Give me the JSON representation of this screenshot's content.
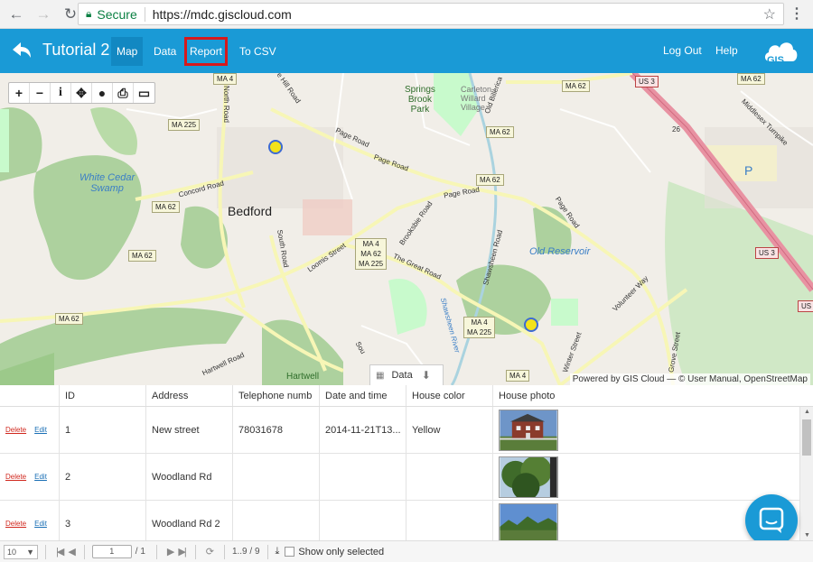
{
  "browser": {
    "secure_label": "Secure",
    "url": "https://mdc.giscloud.com"
  },
  "header": {
    "title": "Tutorial 2",
    "tabs": [
      {
        "label": "Map",
        "active": true
      },
      {
        "label": "Data",
        "active": false
      },
      {
        "label": "Report",
        "active": false,
        "highlighted": true
      },
      {
        "label": "To CSV",
        "active": false
      }
    ],
    "logout": "Log Out",
    "help": "Help",
    "logo_text": "GIS"
  },
  "map": {
    "toolbar_icons": [
      "zoom-in-icon",
      "zoom-out-icon",
      "info-icon",
      "pan-icon",
      "globe-icon",
      "print-icon",
      "layers-icon"
    ],
    "places": {
      "town": "Bedford",
      "white_cedar": "White Cedar\nSwamp",
      "old_reservoir": "Old Reservoir",
      "springs_brook": "Springs\nBrook\nPark",
      "carleton": "Carleton-\nWillard\nVillage",
      "hartwell": "Hartwell"
    },
    "roads": {
      "north_road": "North Road",
      "page_road1": "Page Road",
      "page_road2": "Page Road",
      "page_road3": "Page Road",
      "page_road4": "Page Road",
      "concord_road": "Concord Road",
      "south_road": "South Road",
      "loomis": "Loomis Street",
      "great_road": "The Great Road",
      "brooksbie": "Brooksbie Road",
      "shawsheen_road": "Shawsheen Road",
      "shawsheen_river": "Shawsheen River",
      "hartwell_road": "Hartwell Road",
      "volunteer": "Volunteer Way",
      "winter": "Winter Street",
      "grove": "Grove Street",
      "hill_road": "e Hill Road",
      "middlesex": "Middlesex Turnpike",
      "old_billerica": "Old Billerica",
      "south_right": "Sou"
    },
    "shields": {
      "ma4_top": "MA 4",
      "ma225_left": "MA 225",
      "ma62_left1": "MA 62",
      "ma62_left2": "MA 62",
      "ma62_left3": "MA 62",
      "ma62_top_right": "MA 62",
      "ma62_mid": "MA 62",
      "ma62_mid2": "MA 62",
      "ma62_far_right": "MA 62",
      "junction": "MA 4\nMA 62\nMA 225",
      "ma4_ma225": "MA 4\nMA 225",
      "ma4_bottom": "MA 4",
      "us3_top": "US 3",
      "us3_right": "US 3",
      "us3_edge": "US",
      "route26": "26",
      "parking": "P"
    },
    "data_toggle_label": "Data",
    "attribution": "Powered by GIS Cloud — © User Manual, OpenStreetMap"
  },
  "table": {
    "columns": [
      "",
      "ID",
      "Address",
      "Telephone numb",
      "Date and time",
      "House color",
      "House photo"
    ],
    "delete_label": "Delete",
    "edit_label": "Edit",
    "rows": [
      {
        "id": "1",
        "address": "New street",
        "phone": "78031678",
        "datetime": "2014-11-21T13...",
        "color": "Yellow"
      },
      {
        "id": "2",
        "address": "Woodland Rd",
        "phone": "",
        "datetime": "",
        "color": ""
      },
      {
        "id": "3",
        "address": "Woodland Rd 2",
        "phone": "",
        "datetime": "",
        "color": ""
      }
    ]
  },
  "pager": {
    "page_size": "10",
    "current_page": "1",
    "total_pages": "/ 1",
    "range": "1..9 / 9",
    "show_selected": "Show only selected"
  },
  "colors": {
    "header_bg": "#1a9ad6",
    "active_tab": "#1288c2",
    "highlight_outline": "#d7191c",
    "marker_fill": "#f3e21b",
    "marker_stroke": "#3d6bd3"
  }
}
